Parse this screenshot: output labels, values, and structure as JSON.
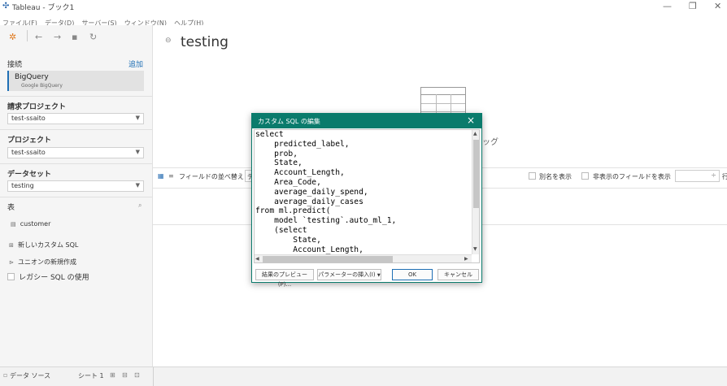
{
  "window": {
    "title": "Tableau - ブック1",
    "minimize": "—",
    "restore": "❐",
    "close": "✕"
  },
  "menu": [
    "ファイル(F)",
    "データ(D)",
    "サーバー(S)",
    "ウィンドウ(N)",
    "ヘルプ(H)"
  ],
  "sidebar": {
    "connections_label": "接続",
    "add_label": "追加",
    "connection": {
      "name": "BigQuery",
      "subtitle": "Google BigQuery"
    },
    "billing_project_label": "請求プロジェクト",
    "billing_project_value": "test-ssaito",
    "project_label": "プロジェクト",
    "project_value": "test-ssaito",
    "dataset_label": "データセット",
    "dataset_value": "testing",
    "table_label": "表",
    "tables": [
      "customer"
    ],
    "new_custom_sql": "新しいカスタム SQL",
    "new_union": "ユニオンの新規作成",
    "legacy_sql": "レガシー SQL の使用"
  },
  "main": {
    "datasource_title": "testing",
    "canvas_hint_fragment": "ッグ",
    "sort_fields_label": "フィールドの並べ替え",
    "sort_fields_value_fragment": "デ",
    "show_aliases": "別名を表示",
    "show_hidden_fields": "非表示のフィールドを表示",
    "right_fragment": "行"
  },
  "dialog": {
    "title": "カスタム SQL の編集",
    "sql": "select\n    predicted_label,\n    prob,\n    State,\n    Account_Length,\n    Area_Code,\n    average_daily_spend,\n    average_daily_cases\nfrom ml.predict(\n    model `testing`.auto_ml_1,\n    (select\n        State,\n        Account_Length,",
    "preview_button": "結果のプレビュー(P)...",
    "insert_param_button": "パラメーターの挿入(I)",
    "ok_button": "OK",
    "cancel_button": "キャンセル"
  },
  "bottom": {
    "datasource_tab": "データ ソース",
    "sheet_tab": "シート 1"
  }
}
